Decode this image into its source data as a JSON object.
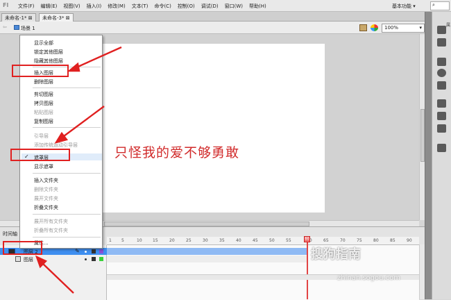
{
  "app": {
    "logo": "Fl"
  },
  "menubar": {
    "items": [
      "文件(F)",
      "编辑(E)",
      "视图(V)",
      "插入(I)",
      "修改(M)",
      "文本(T)",
      "命令(C)",
      "控制(O)",
      "调试(D)",
      "窗口(W)",
      "帮助(H)"
    ],
    "workspace": "基本功能 ▾",
    "search": "⌕"
  },
  "tabs": [
    "未命名-1* ⊠",
    "未命名-3* ⊠"
  ],
  "scene": {
    "label": "场景 1"
  },
  "zoom": {
    "value": "100%"
  },
  "stage": {
    "text": "只怪我的爱不够勇敢"
  },
  "context_menu": {
    "items": [
      "显示全部",
      "锁定其他图层",
      "隐藏其他图层",
      "插入图层",
      "删除图层",
      "剪切图层",
      "拷贝图层",
      "粘贴图层",
      "复制图层",
      "引导层",
      "添加传统运动引导层",
      "遮罩层",
      "显示遮罩",
      "插入文件夹",
      "删除文件夹",
      "展开文件夹",
      "折叠文件夹",
      "展开所有文件夹",
      "折叠所有文件夹",
      "属性..."
    ]
  },
  "right_panel": {
    "label": "属"
  },
  "timeline": {
    "label": "时间轴",
    "ticks": [
      "1",
      "5",
      "10",
      "15",
      "20",
      "25",
      "30",
      "35",
      "40",
      "45",
      "50",
      "55",
      "60",
      "65",
      "70",
      "75",
      "80",
      "85",
      "90"
    ],
    "layers": [
      {
        "name": "图层 2",
        "color": "#8a4fd8",
        "selected": true
      },
      {
        "name": "图层",
        "color": "#3ad13a",
        "selected": false
      }
    ],
    "playhead": "60"
  },
  "watermark": {
    "main": "搜狗指南",
    "url": "zhinan.sogou.com"
  },
  "colors": {
    "annotation": "#e02020",
    "stage_text": "#d12a2a",
    "selection": "#3f8ff0"
  }
}
